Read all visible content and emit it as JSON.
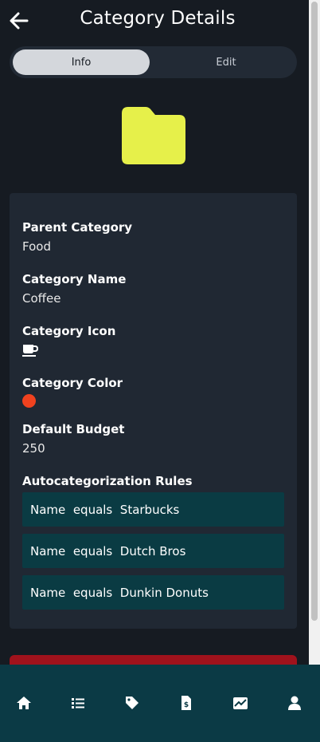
{
  "header": {
    "title": "Category Details"
  },
  "tabs": {
    "info": "Info",
    "edit": "Edit",
    "active": "Info"
  },
  "colors": {
    "folder": "#e6f04a",
    "category_color": "#f0421f",
    "rule_bg": "#0a3b43",
    "delete": "#a0121c",
    "nav_bg": "#0b3a45"
  },
  "details": {
    "parent_category_label": "Parent Category",
    "parent_category_value": "Food",
    "category_name_label": "Category Name",
    "category_name_value": "Coffee",
    "category_icon_label": "Category Icon",
    "category_icon_value": "mug-icon",
    "category_color_label": "Category Color",
    "default_budget_label": "Default Budget",
    "default_budget_value": "250",
    "rules_label": "Autocategorization Rules"
  },
  "rules": [
    {
      "field": "Name",
      "op": "equals",
      "value": "Starbucks"
    },
    {
      "field": "Name",
      "op": "equals",
      "value": "Dutch Bros"
    },
    {
      "field": "Name",
      "op": "equals",
      "value": "Dunkin Donuts"
    }
  ],
  "nav": [
    {
      "icon": "home-icon"
    },
    {
      "icon": "list-icon"
    },
    {
      "icon": "tag-icon"
    },
    {
      "icon": "receipt-dollar-icon"
    },
    {
      "icon": "trending-chart-icon"
    },
    {
      "icon": "user-icon"
    }
  ]
}
